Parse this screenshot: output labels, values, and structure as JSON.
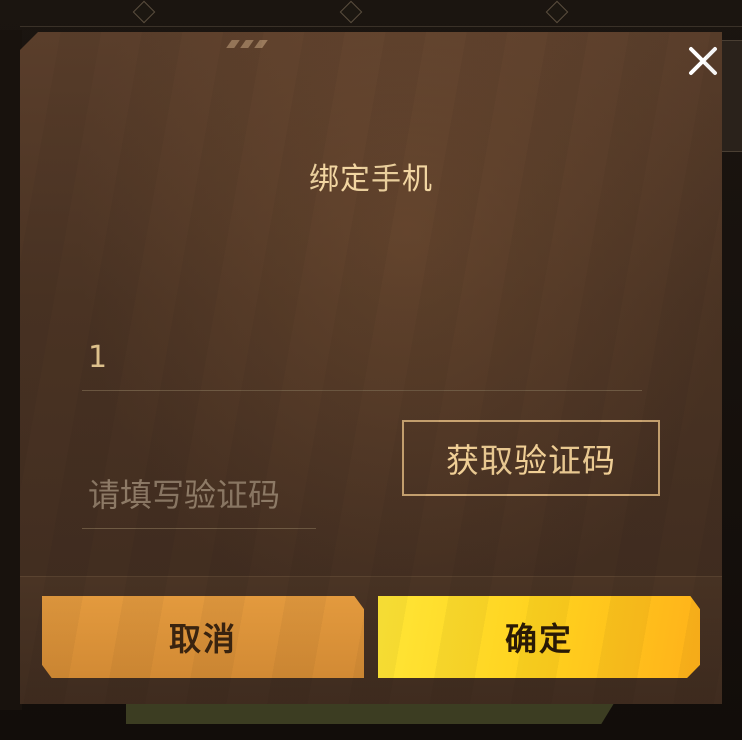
{
  "dialog": {
    "title": "绑定手机",
    "close_icon": "close-icon",
    "phone_input": {
      "value": "1",
      "placeholder": ""
    },
    "code_input": {
      "value": "",
      "placeholder": "请填写验证码"
    },
    "get_code_label": "获取验证码",
    "cancel_label": "取消",
    "confirm_label": "确定"
  },
  "colors": {
    "title": "#f2d6a2",
    "accent_gold": "#caa471",
    "cancel_bg": "#e39a3e",
    "confirm_bg": "#ffd21e",
    "dialog_bg": "#4a3323"
  }
}
